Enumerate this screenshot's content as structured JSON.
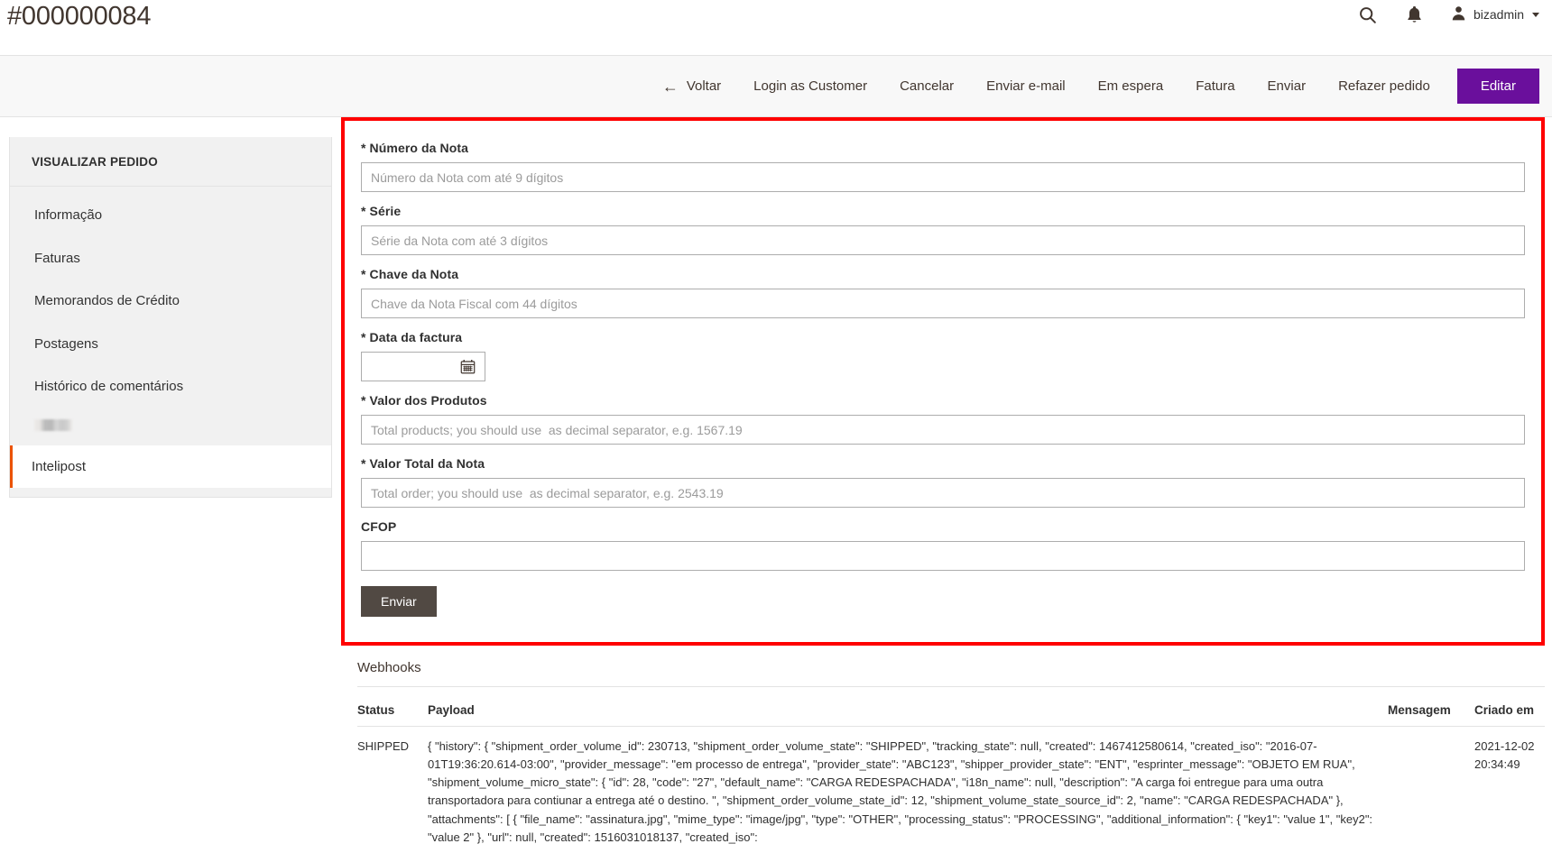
{
  "header": {
    "order_title": "#000000084",
    "search_icon": "search-icon",
    "notifications_icon": "bell-icon",
    "user_icon": "user-avatar-icon",
    "admin_user": "bizadmin"
  },
  "actions": {
    "back": "Voltar",
    "back_arrow": "←",
    "login_as_customer": "Login as Customer",
    "cancel": "Cancelar",
    "send_email": "Enviar e-mail",
    "hold": "Em espera",
    "invoice": "Fatura",
    "ship": "Enviar",
    "reorder": "Refazer pedido",
    "edit": "Editar",
    "edit_color": "#6a0f9c"
  },
  "sidebar": {
    "title": "VISUALIZAR PEDIDO",
    "items": [
      {
        "label": "Informação",
        "active": false,
        "redacted": false
      },
      {
        "label": "Faturas",
        "active": false,
        "redacted": false
      },
      {
        "label": "Memorandos de Crédito",
        "active": false,
        "redacted": false
      },
      {
        "label": "Postagens",
        "active": false,
        "redacted": false
      },
      {
        "label": "Histórico de comentários",
        "active": false,
        "redacted": false
      },
      {
        "label": "",
        "active": false,
        "redacted": true
      },
      {
        "label": "Intelipost",
        "active": true,
        "redacted": false
      }
    ],
    "active_marker_color": "#eb5202"
  },
  "form": {
    "highlight_border_color": "#ff0000",
    "fields": [
      {
        "label": "* Número da Nota",
        "placeholder": "Número da Nota com até 9 dígitos",
        "value": "",
        "type": "text"
      },
      {
        "label": "* Série",
        "placeholder": "Série da Nota com até 3 dígitos",
        "value": "",
        "type": "text"
      },
      {
        "label": "* Chave da Nota",
        "placeholder": "Chave da Nota Fiscal com 44 dígitos",
        "value": "",
        "type": "text"
      },
      {
        "label": "* Data da factura",
        "placeholder": "",
        "value": "",
        "type": "date"
      },
      {
        "label": "* Valor dos Produtos",
        "placeholder": "Total products; you should use  as decimal separator, e.g. 1567.19",
        "value": "",
        "type": "text"
      },
      {
        "label": "* Valor Total da Nota",
        "placeholder": "Total order; you should use  as decimal separator, e.g. 2543.19",
        "value": "",
        "type": "text"
      },
      {
        "label": "CFOP",
        "placeholder": "",
        "value": "",
        "type": "text"
      }
    ],
    "calendar_icon": "calendar-icon",
    "submit_label": "Enviar"
  },
  "webhooks": {
    "title": "Webhooks",
    "columns": [
      "Status",
      "Payload",
      "Mensagem",
      "Criado em"
    ],
    "rows": [
      {
        "status": "SHIPPED",
        "payload": "{ \"history\": { \"shipment_order_volume_id\": 230713, \"shipment_order_volume_state\": \"SHIPPED\", \"tracking_state\": null, \"created\": 1467412580614, \"created_iso\": \"2016-07-01T19:36:20.614-03:00\", \"provider_message\": \"em processo de entrega\", \"provider_state\": \"ABC123\", \"shipper_provider_state\": \"ENT\", \"esprinter_message\": \"OBJETO EM RUA\", \"shipment_volume_micro_state\": { \"id\": 28, \"code\": \"27\", \"default_name\": \"CARGA REDESPACHADA\", \"i18n_name\": null, \"description\": \"A carga foi entregue para uma outra transportadora para contiunar a entrega até o destino. \", \"shipment_order_volume_state_id\": 12, \"shipment_volume_state_source_id\": 2, \"name\": \"CARGA REDESPACHADA\" }, \"attachments\": [ { \"file_name\": \"assinatura.jpg\", \"mime_type\": \"image/jpg\", \"type\": \"OTHER\", \"processing_status\": \"PROCESSING\", \"additional_information\": { \"key1\": \"value 1\", \"key2\": \"value 2\" }, \"url\": null, \"created\": 1516031018137, \"created_iso\":",
        "message": "",
        "created_at": "2021-12-02 20:34:49"
      }
    ]
  }
}
